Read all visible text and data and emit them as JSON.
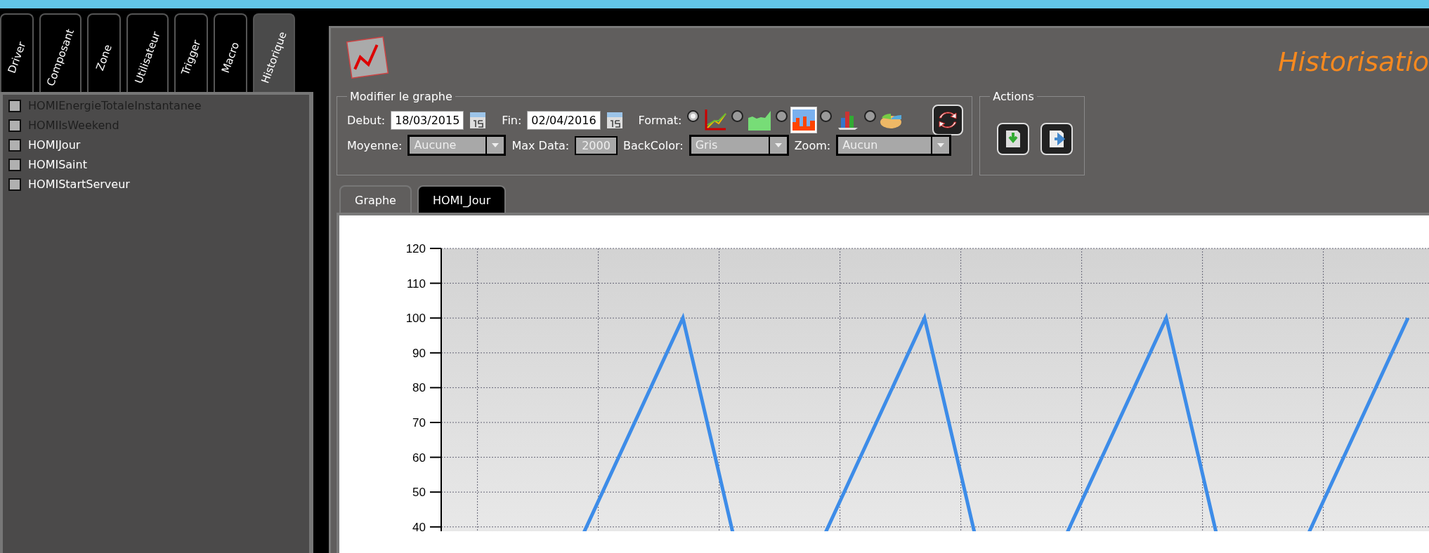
{
  "side_tabs": [
    {
      "label": "Driver",
      "selected": false
    },
    {
      "label": "Composant",
      "selected": false
    },
    {
      "label": "Zone",
      "selected": false
    },
    {
      "label": "Utilisateur",
      "selected": false
    },
    {
      "label": "Trigger",
      "selected": false
    },
    {
      "label": "Macro",
      "selected": false
    },
    {
      "label": "Historique",
      "selected": true
    }
  ],
  "sidebar": {
    "items": [
      {
        "label": "HOMIEnergieTotaleInstantanee",
        "checked": false,
        "disabled": true
      },
      {
        "label": "HOMIIsWeekend",
        "checked": false,
        "disabled": true
      },
      {
        "label": "HOMIJour",
        "checked": false,
        "disabled": false
      },
      {
        "label": "HOMISaint",
        "checked": false,
        "disabled": false
      },
      {
        "label": "HOMIStartServeur",
        "checked": false,
        "disabled": false
      }
    ]
  },
  "header": {
    "title": "Historisatio"
  },
  "graph_settings": {
    "legend": "Modifier le graphe",
    "start": {
      "label": "Debut:",
      "value": "18/03/2015"
    },
    "end": {
      "label": "Fin:",
      "value": "02/04/2016"
    },
    "format": {
      "label": "Format:",
      "options": [
        {
          "kind": "line",
          "selected": true,
          "highlighted": false
        },
        {
          "kind": "area",
          "selected": false,
          "highlighted": false
        },
        {
          "kind": "histogram",
          "selected": false,
          "highlighted": true
        },
        {
          "kind": "bars",
          "selected": false,
          "highlighted": false
        },
        {
          "kind": "pie",
          "selected": false,
          "highlighted": false
        }
      ]
    },
    "average": {
      "label": "Moyenne:",
      "value": "Aucune"
    },
    "max_data": {
      "label": "Max Data:",
      "value": "2000"
    },
    "back_color": {
      "label": "BackColor:",
      "value": "Gris"
    },
    "zoom": {
      "label": "Zoom:",
      "value": "Aucun"
    }
  },
  "actions": {
    "legend": "Actions"
  },
  "view_tabs": [
    {
      "label": "Graphe",
      "selected": false
    },
    {
      "label": "HOMI_Jour",
      "selected": true
    }
  ],
  "chart": {
    "y_labels": [
      "120",
      "110",
      "100",
      "90",
      "80",
      "70",
      "60",
      "50",
      "40"
    ]
  }
}
